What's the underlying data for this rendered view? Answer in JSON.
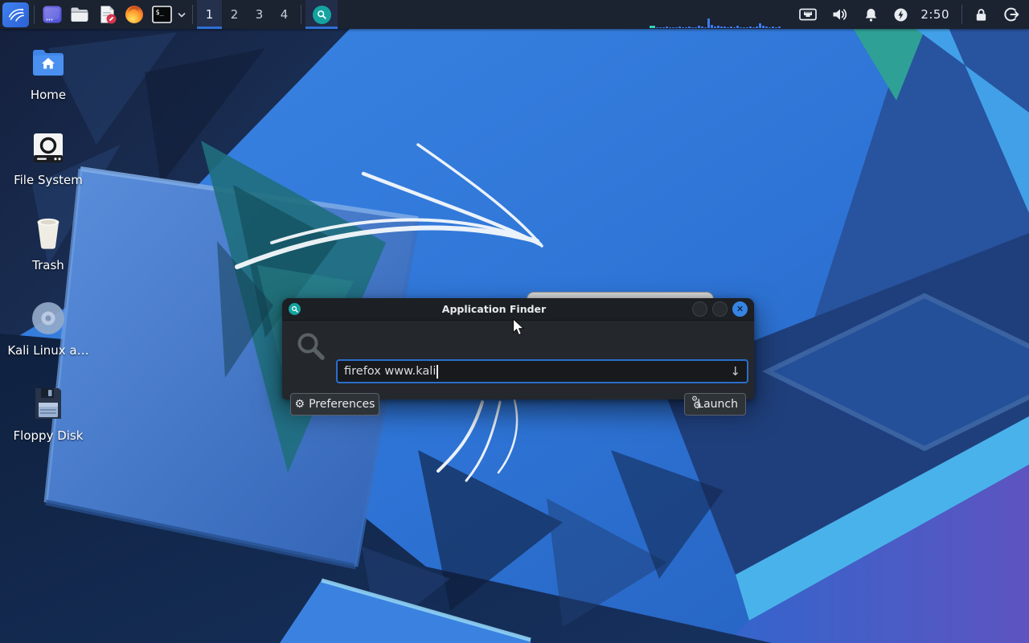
{
  "panel": {
    "menu": {
      "name": "kali-applications-menu"
    },
    "launchers": {
      "terminal_label": "$_"
    },
    "workspaces": {
      "items": [
        "1",
        "2",
        "3",
        "4"
      ],
      "active": "1"
    },
    "taskbar": {
      "app": "Application Finder"
    },
    "monitor": {
      "bars": [
        3,
        1,
        1,
        1,
        2,
        1,
        1,
        1,
        2,
        1,
        1,
        2,
        1,
        1,
        3,
        2,
        1,
        12,
        4,
        2,
        3,
        2,
        2,
        1,
        2,
        1,
        3,
        1,
        1,
        1,
        2,
        1,
        2,
        6,
        3,
        2,
        1,
        2,
        1,
        2
      ],
      "accent_index": 0,
      "accent_color": "#35d0ba",
      "bar_color": "#3d7bf4"
    },
    "clock": "2:50"
  },
  "desktop": {
    "icons": [
      {
        "label": "Home"
      },
      {
        "label": "File System"
      },
      {
        "label": "Trash"
      },
      {
        "label": "Kali Linux a…"
      },
      {
        "label": "Floppy Disk"
      }
    ]
  },
  "finder": {
    "title": "Application Finder",
    "search": {
      "value": "firefox www.kali"
    },
    "buttons": {
      "preferences": "Preferences",
      "launch": "Launch"
    }
  },
  "colors": {
    "accent": "#2e6fd4",
    "close_button": "#3584e4",
    "panel_bg": "#1b2230",
    "input_border": "#2a6ecb"
  }
}
